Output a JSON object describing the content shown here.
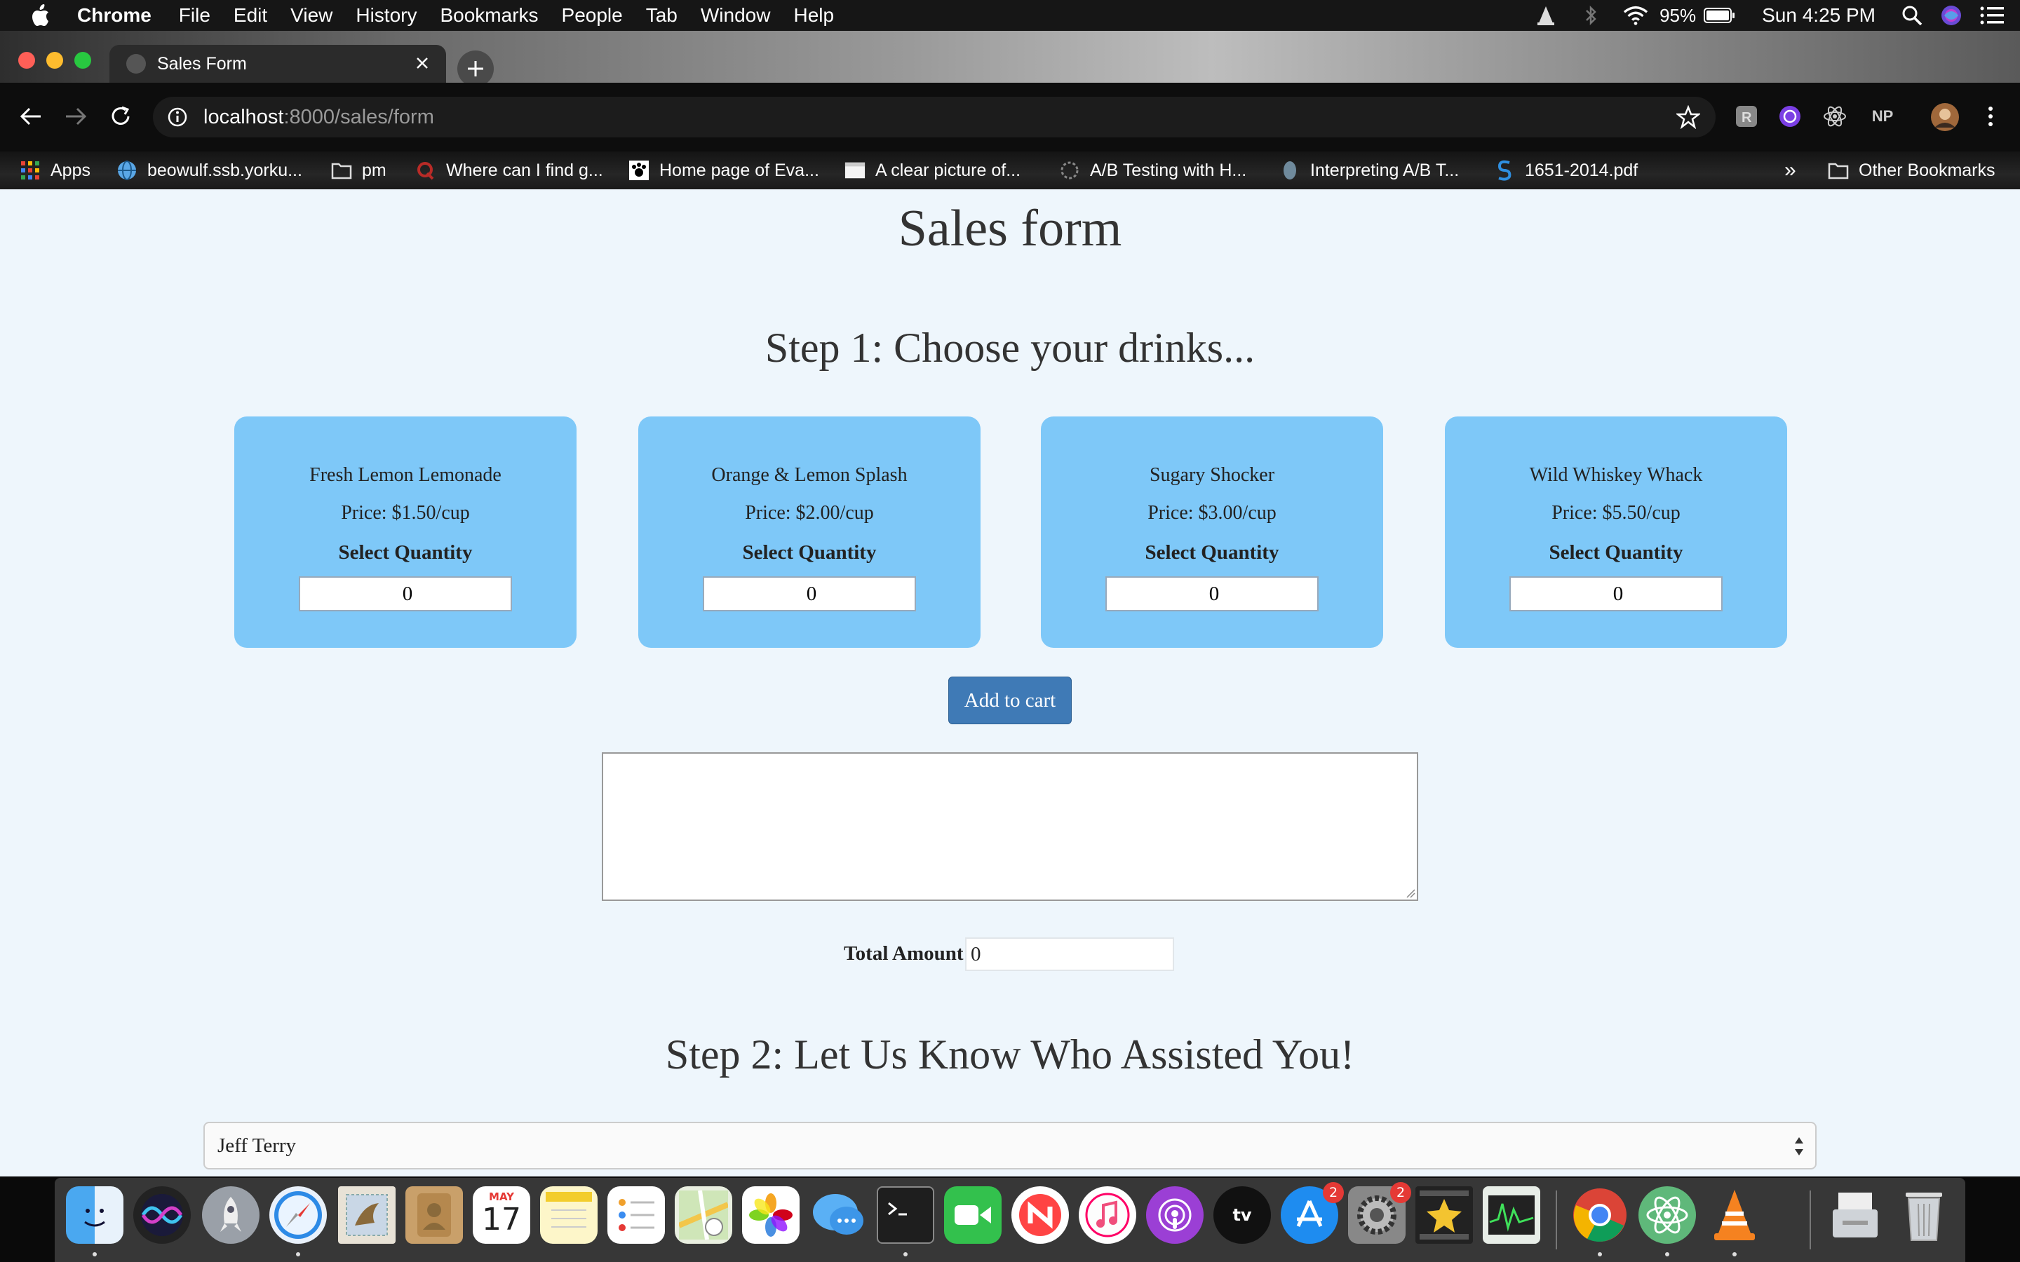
{
  "menubar": {
    "app_name": "Chrome",
    "items": [
      "File",
      "Edit",
      "View",
      "History",
      "Bookmarks",
      "People",
      "Tab",
      "Window",
      "Help"
    ],
    "battery": "95%",
    "clock": "Sun 4:25 PM"
  },
  "browser": {
    "tab_title": "Sales Form",
    "url_host": "localhost",
    "url_path": ":8000/sales/form",
    "extensions": [
      "NP"
    ],
    "bookmarks": [
      "Apps",
      "beowulf.ssb.yorku...",
      "pm",
      "Where can I find g...",
      "Home page of Eva...",
      "A clear picture of...",
      "A/B Testing with H...",
      "Interpreting A/B T...",
      "1651-2014.pdf"
    ],
    "bookmarks_overflow": "»",
    "other_bookmarks": "Other Bookmarks"
  },
  "page": {
    "title": "Sales form",
    "step1_title": "Step 1: Choose your drinks...",
    "drinks": [
      {
        "name": "Fresh Lemon Lemonade",
        "price": "Price: $1.50/cup",
        "qty_label": "Select Quantity",
        "qty": "0"
      },
      {
        "name": "Orange & Lemon Splash",
        "price": "Price: $2.00/cup",
        "qty_label": "Select Quantity",
        "qty": "0"
      },
      {
        "name": "Sugary Shocker",
        "price": "Price: $3.00/cup",
        "qty_label": "Select Quantity",
        "qty": "0"
      },
      {
        "name": "Wild Whiskey Whack",
        "price": "Price: $5.50/cup",
        "qty_label": "Select Quantity",
        "qty": "0"
      }
    ],
    "add_to_cart": "Add to cart",
    "cart_text": "",
    "total_label": "Total Amount",
    "total_value": "0",
    "step2_title": "Step 2: Let Us Know Who Assisted You!",
    "assistant_selected": "Jeff Terry"
  },
  "dock": {
    "icons": [
      "finder-icon",
      "siri-icon",
      "launchpad-icon",
      "safari-icon",
      "mail-icon",
      "contacts-icon",
      "calendar-icon",
      "notes-icon",
      "reminders-icon",
      "maps-icon",
      "photos-icon",
      "messages-icon",
      "terminal-icon",
      "facetime-icon",
      "news-icon",
      "music-icon",
      "podcasts-icon",
      "tv-icon",
      "app-store-icon",
      "system-preferences-icon",
      "imovie-icon",
      "activity-monitor-icon",
      "chrome-icon",
      "atom-icon",
      "vlc-icon",
      "documents-folder-icon",
      "trash-icon"
    ],
    "calendar_month": "MAY",
    "calendar_day": "17",
    "tv_label": "tv",
    "app_store_badge": "2",
    "system_preferences_badge": "2"
  }
}
